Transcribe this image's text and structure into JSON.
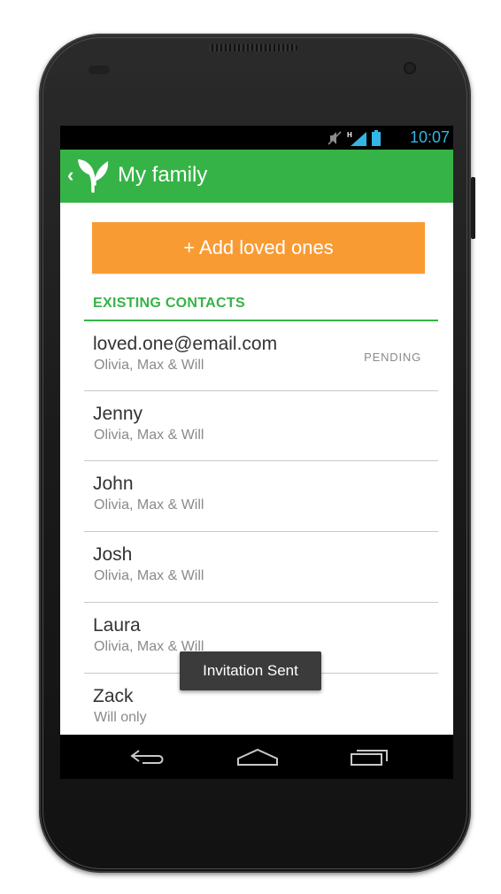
{
  "device": {
    "status_time": "10:07",
    "status_icons": [
      "mute-icon",
      "signal-h-icon",
      "battery-icon"
    ],
    "accent_status": "#33b5e5"
  },
  "actionbar": {
    "title": "My family",
    "color": "#36b346",
    "icons": [
      "back-chevron-icon",
      "app-logo-icon"
    ]
  },
  "main": {
    "add_button_label": "+ Add loved ones",
    "add_button_color": "#f99b33",
    "section_header": "EXISTING CONTACTS",
    "contacts": [
      {
        "name": "loved.one@email.com",
        "detail": "Olivia, Max & Will",
        "badge": "PENDING"
      },
      {
        "name": "Jenny",
        "detail": "Olivia, Max & Will",
        "badge": ""
      },
      {
        "name": "John",
        "detail": "Olivia, Max & Will",
        "badge": ""
      },
      {
        "name": "Josh",
        "detail": "Olivia, Max & Will",
        "badge": ""
      },
      {
        "name": "Laura",
        "detail": "Olivia, Max & Will",
        "badge": ""
      },
      {
        "name": "Zack",
        "detail": "Will only",
        "badge": ""
      }
    ]
  },
  "toast": {
    "text": "Invitation Sent"
  },
  "navbar": {
    "icons": [
      "back-icon",
      "home-icon",
      "recent-apps-icon"
    ]
  }
}
